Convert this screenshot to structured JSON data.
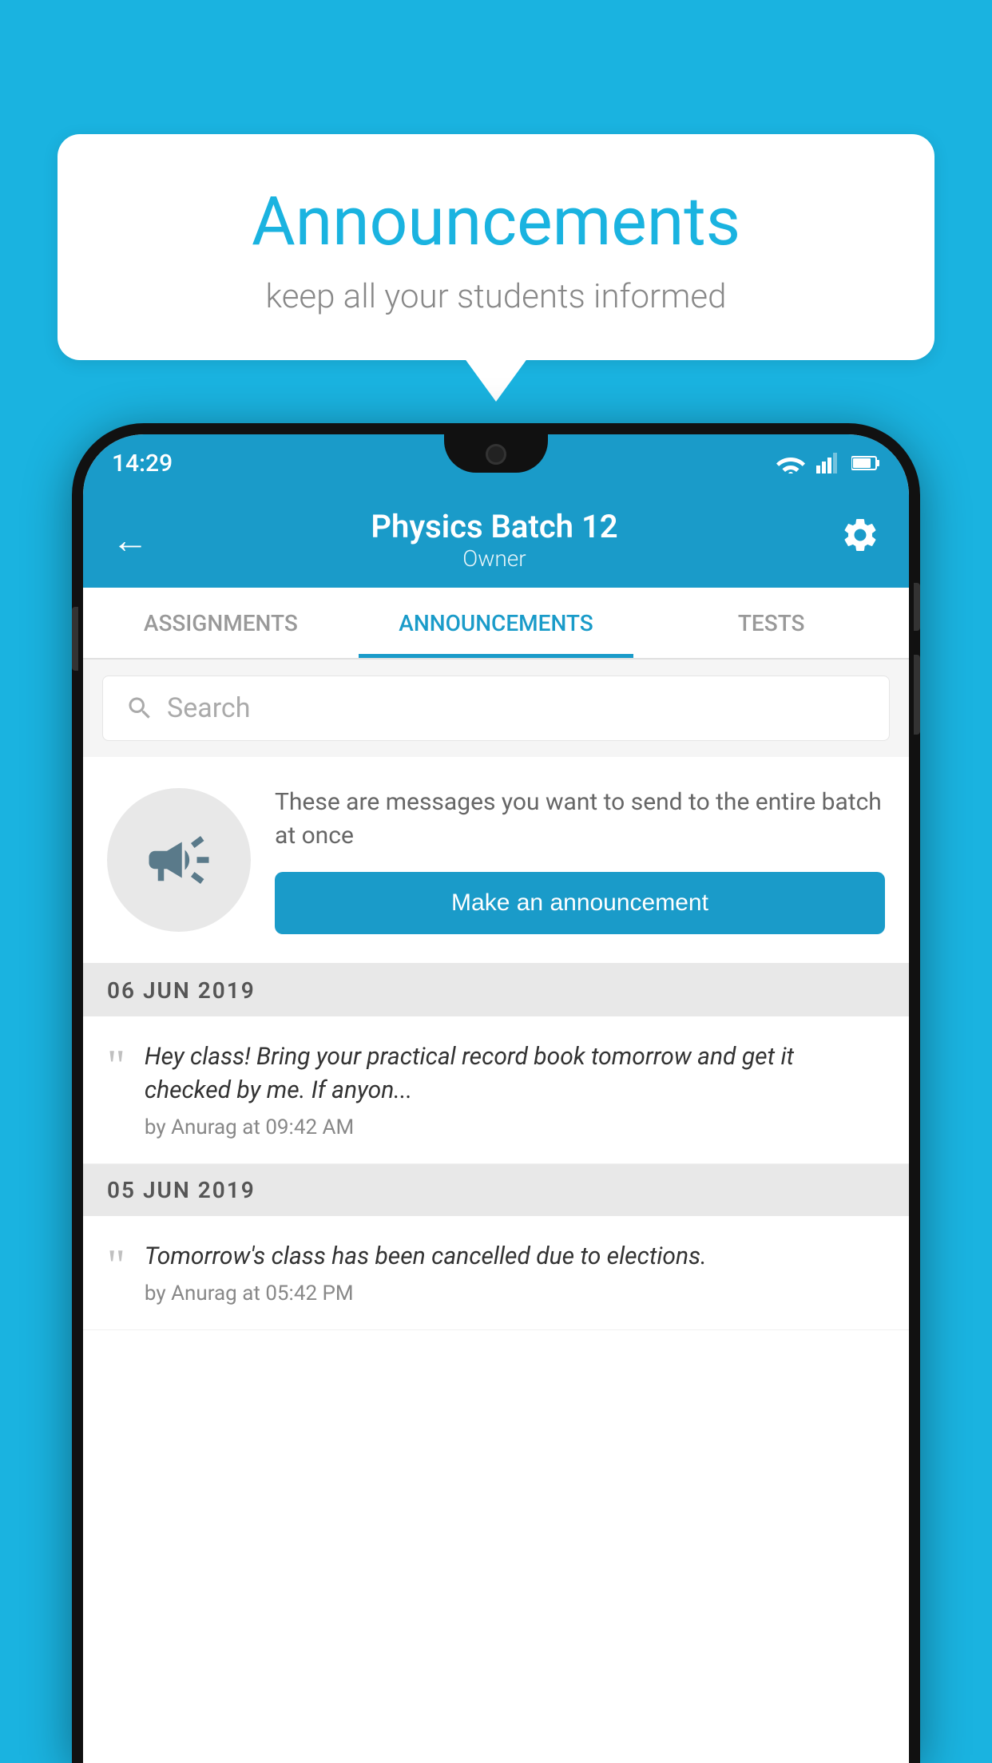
{
  "background_color": "#1ab3e0",
  "speech_bubble": {
    "title": "Announcements",
    "subtitle": "keep all your students informed"
  },
  "status_bar": {
    "time": "14:29"
  },
  "app_bar": {
    "title": "Physics Batch 12",
    "subtitle": "Owner",
    "back_label": "←",
    "settings_label": "⚙"
  },
  "tabs": [
    {
      "label": "ASSIGNMENTS",
      "active": false
    },
    {
      "label": "ANNOUNCEMENTS",
      "active": true
    },
    {
      "label": "TESTS",
      "active": false
    },
    {
      "label": "···",
      "active": false
    }
  ],
  "search": {
    "placeholder": "Search"
  },
  "promo": {
    "description": "These are messages you want to send to the entire batch at once",
    "button_label": "Make an announcement"
  },
  "announcements": [
    {
      "date": "06  JUN  2019",
      "text": "Hey class! Bring your practical record book tomorrow and get it checked by me. If anyon...",
      "meta": "by Anurag at 09:42 AM"
    },
    {
      "date": "05  JUN  2019",
      "text": "Tomorrow's class has been cancelled due to elections.",
      "meta": "by Anurag at 05:42 PM"
    }
  ]
}
